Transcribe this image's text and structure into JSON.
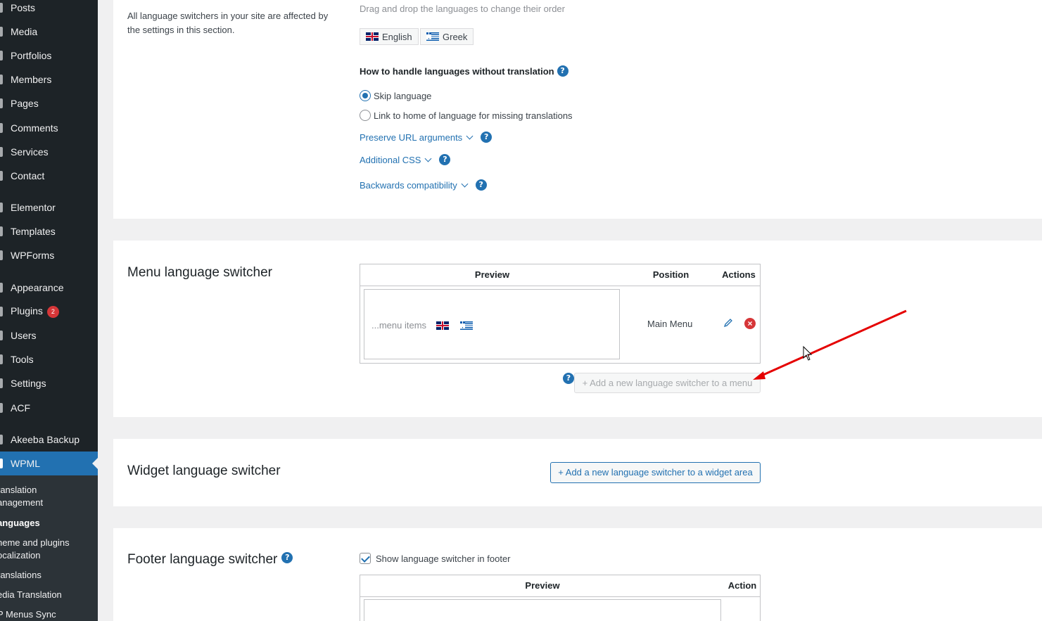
{
  "sidebar": {
    "items": [
      {
        "label": "Posts"
      },
      {
        "label": "Media"
      },
      {
        "label": "Portfolios"
      },
      {
        "label": "Members"
      },
      {
        "label": "Pages"
      },
      {
        "label": "Comments"
      },
      {
        "label": "Services"
      },
      {
        "label": "Contact"
      },
      {
        "label": "Elementor"
      },
      {
        "label": "Templates"
      },
      {
        "label": "WPForms"
      },
      {
        "label": "Appearance"
      },
      {
        "label": "Plugins",
        "badge": "2"
      },
      {
        "label": "Users"
      },
      {
        "label": "Tools"
      },
      {
        "label": "Settings"
      },
      {
        "label": "ACF"
      },
      {
        "label": "Akeeba Backup"
      },
      {
        "label": "WPML"
      }
    ],
    "submenu": [
      {
        "label": "ranslation\nanagement"
      },
      {
        "label": "anguages"
      },
      {
        "label": "heme and plugins\nocalization"
      },
      {
        "label": "ranslations"
      },
      {
        "label": "edia Translation"
      },
      {
        "label": "P Menus Sync"
      }
    ]
  },
  "general": {
    "description": "All language switchers in your site are affected by the settings in this section.",
    "drag_hint": "Drag and drop the languages to change their order",
    "languages": [
      "English",
      "Greek"
    ],
    "missing_translation_label": "How to handle languages without translation",
    "options": [
      "Skip language",
      "Link to home of language for missing translations"
    ],
    "selected_option": 0,
    "links": [
      "Preserve URL arguments",
      "Additional CSS",
      "Backwards compatibility"
    ]
  },
  "menu_switcher": {
    "title": "Menu language switcher",
    "headers": {
      "preview": "Preview",
      "position": "Position",
      "actions": "Actions"
    },
    "preview_text": "...menu items",
    "position": "Main Menu",
    "add_button": "+ Add a new language switcher to a menu"
  },
  "widget_switcher": {
    "title": "Widget language switcher",
    "add_button": "+ Add a new language switcher to a widget area"
  },
  "footer_switcher": {
    "title": "Footer language switcher",
    "checkbox_label": "Show language switcher in footer",
    "checkbox_checked": true,
    "headers": {
      "preview": "Preview",
      "action": "Action"
    }
  },
  "help_glyph": "?",
  "colors": {
    "accent": "#2271b1",
    "sidebar": "#1d2327",
    "danger": "#d63638",
    "annotation": "#e50000"
  }
}
